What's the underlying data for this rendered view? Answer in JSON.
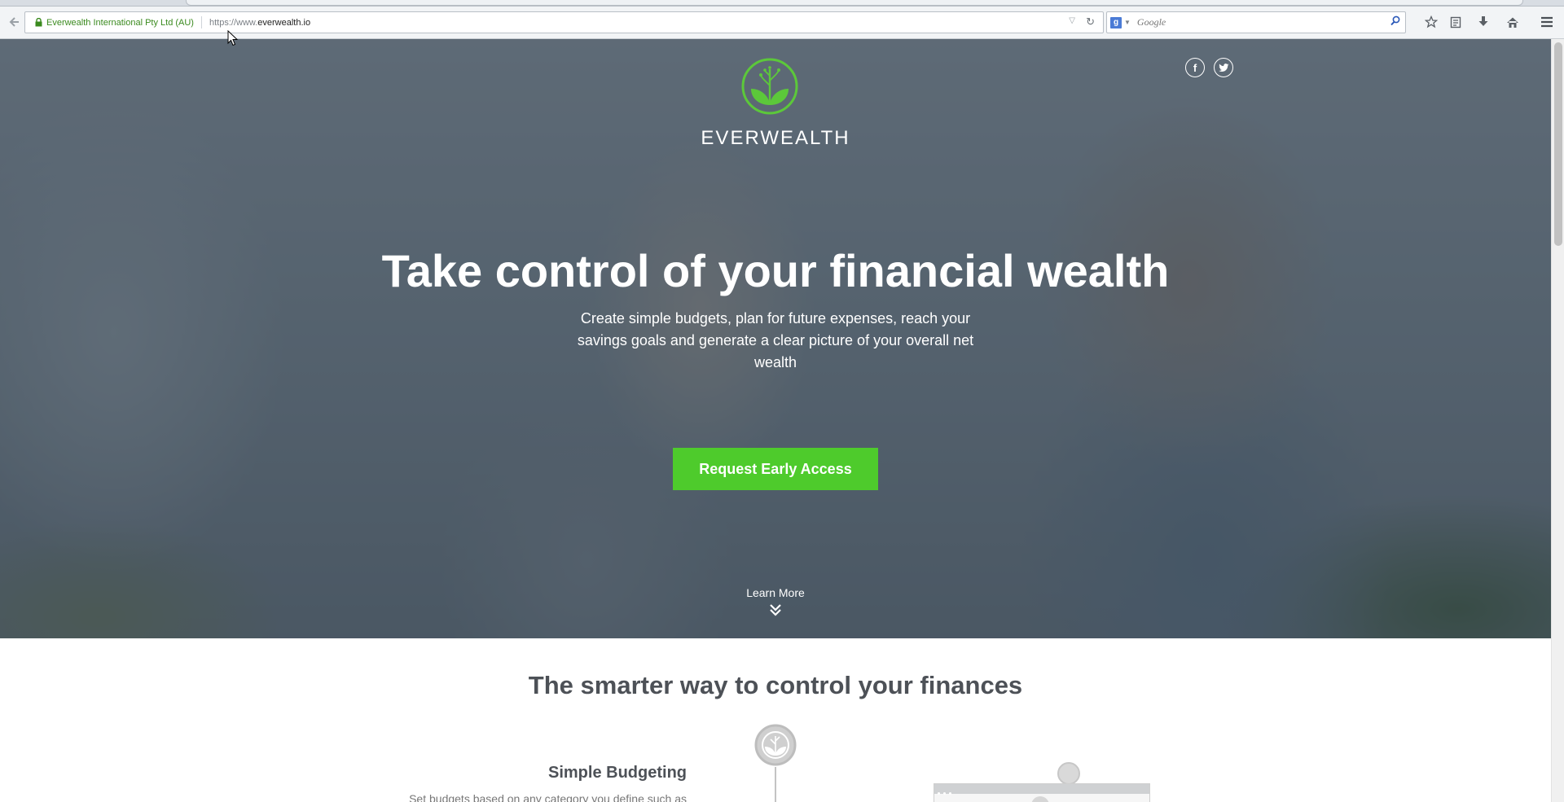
{
  "browser": {
    "identity": "Everwealth International Pty Ltd (AU)",
    "url_prefix": "https://www.",
    "url_domain": "everwealth.io",
    "search_placeholder": "Google",
    "search_engine_icon": "google-g-icon"
  },
  "hero": {
    "brand": "EVERWEALTH",
    "social": [
      "facebook-icon",
      "twitter-icon"
    ],
    "facebook_glyph": "f",
    "title": "Take control of your financial wealth",
    "subtitle": "Create simple budgets, plan for future expenses, reach your savings goals and generate a clear picture of your overall net wealth",
    "cta_label": "Request Early Access",
    "learn_more": "Learn More"
  },
  "features": {
    "title": "The smarter way to control your finances",
    "items": [
      {
        "heading": "Simple Budgeting",
        "text": "Set budgets based on any category you define such as"
      }
    ]
  },
  "colors": {
    "brand_green": "#4ecb2c",
    "logo_green": "#5cc83a",
    "heading_gray": "#4d5157",
    "hero_overlay": "#344250"
  }
}
